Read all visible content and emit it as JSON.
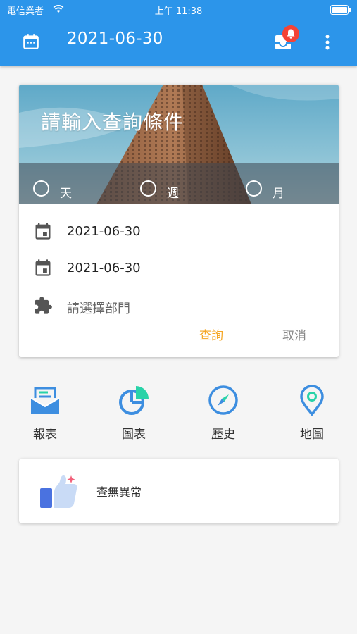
{
  "status_bar": {
    "carrier": "電信業者",
    "time": "上午 11:38"
  },
  "app_bar": {
    "title": "2021-06-30"
  },
  "query_card": {
    "hero_title": "請輸入查詢條件",
    "radio_options": [
      "天",
      "週",
      "月"
    ],
    "start_date": "2021-06-30",
    "end_date": "2021-06-30",
    "department_placeholder": "請選擇部門",
    "query_label": "查詢",
    "cancel_label": "取消"
  },
  "menu": {
    "items": [
      {
        "label": "報表",
        "icon": "report-mail-icon"
      },
      {
        "label": "圖表",
        "icon": "pie-chart-icon"
      },
      {
        "label": "歷史",
        "icon": "compass-icon"
      },
      {
        "label": "地圖",
        "icon": "map-pin-icon"
      }
    ]
  },
  "result": {
    "text": "查無異常",
    "icon": "thumbs-up-icon"
  },
  "colors": {
    "primary": "#2c95ea",
    "accent": "#f5a623",
    "badge": "#f44336",
    "menu_blue": "#3d8ee0",
    "chart_teal": "#29d3a8"
  }
}
